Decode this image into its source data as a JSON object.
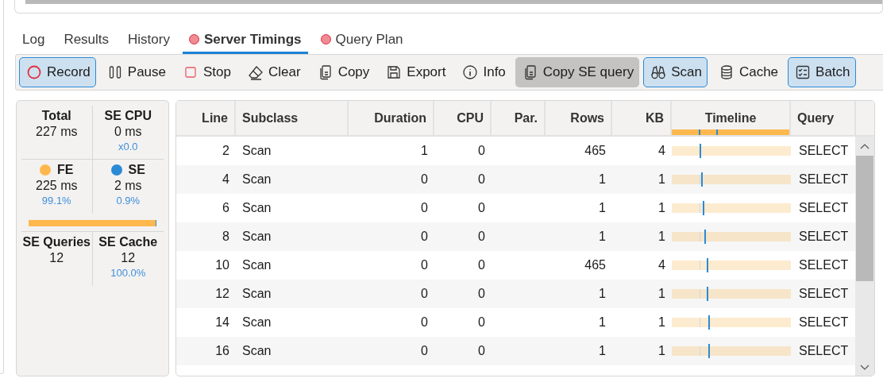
{
  "tabs": [
    {
      "label": "Log",
      "selected": false,
      "indicator": false
    },
    {
      "label": "Results",
      "selected": false,
      "indicator": false
    },
    {
      "label": "History",
      "selected": false,
      "indicator": false
    },
    {
      "label": "Server Timings",
      "selected": true,
      "indicator": true
    },
    {
      "label": "Query Plan",
      "selected": false,
      "indicator": true
    }
  ],
  "toolbar": [
    {
      "label": "Record",
      "kind": "record",
      "selected": true,
      "hovered": false
    },
    {
      "label": "Pause",
      "kind": "pause",
      "selected": false,
      "hovered": false
    },
    {
      "label": "Stop",
      "kind": "stop",
      "selected": false,
      "hovered": false
    },
    {
      "label": "Clear",
      "kind": "eraser",
      "selected": false,
      "hovered": false
    },
    {
      "label": "Copy",
      "kind": "copy",
      "selected": false,
      "hovered": false
    },
    {
      "label": "Export",
      "kind": "save",
      "selected": false,
      "hovered": false
    },
    {
      "label": "Info",
      "kind": "info",
      "selected": false,
      "hovered": false
    },
    {
      "label": "Copy SE query",
      "kind": "copy",
      "selected": false,
      "hovered": true
    },
    {
      "label": "Scan",
      "kind": "binoculars",
      "selected": true,
      "hovered": false
    },
    {
      "label": "Cache",
      "kind": "database",
      "selected": false,
      "hovered": false
    },
    {
      "label": "Batch",
      "kind": "checklist",
      "selected": true,
      "hovered": false
    }
  ],
  "summary": {
    "cells": [
      {
        "title": "Total",
        "value": "227 ms"
      },
      {
        "title": "SE CPU",
        "value": "0 ms",
        "note": "x0.0"
      },
      {
        "title": "FE",
        "value": "225 ms",
        "note": "99.1%",
        "color": "#ffb84d"
      },
      {
        "title": "SE",
        "value": "2 ms",
        "note": "0.9%",
        "color": "#2b8ad6"
      },
      {
        "title": "SE Queries",
        "value": "12"
      },
      {
        "title": "SE Cache",
        "value": "12",
        "note": "100.0%"
      }
    ]
  },
  "table": {
    "columns": [
      "Line",
      "Subclass",
      "Duration",
      "CPU",
      "Par.",
      "Rows",
      "KB",
      "Timeline",
      "Query"
    ],
    "rows": [
      {
        "line": "2",
        "subclass": "Scan",
        "duration": "1",
        "cpu": "0",
        "rows": "465",
        "kb": "4",
        "timeline": {
          "level": 0.23
        },
        "query": "SELECT"
      },
      {
        "line": "4",
        "subclass": "Scan",
        "duration": "0",
        "cpu": "0",
        "rows": "1",
        "kb": "1",
        "timeline": {
          "level": 0.245
        },
        "query": "SELECT"
      },
      {
        "line": "6",
        "subclass": "Scan",
        "duration": "0",
        "cpu": "0",
        "rows": "1",
        "kb": "1",
        "timeline": {
          "level": 0.26
        },
        "query": "SELECT"
      },
      {
        "line": "8",
        "subclass": "Scan",
        "duration": "0",
        "cpu": "0",
        "rows": "1",
        "kb": "1",
        "timeline": {
          "level": 0.275
        },
        "query": "SELECT"
      },
      {
        "line": "10",
        "subclass": "Scan",
        "duration": "0",
        "cpu": "0",
        "rows": "465",
        "kb": "4",
        "timeline": {
          "level": 0.29
        },
        "query": "SELECT"
      },
      {
        "line": "12",
        "subclass": "Scan",
        "duration": "0",
        "cpu": "0",
        "rows": "1",
        "kb": "1",
        "timeline": {
          "level": 0.29
        },
        "query": "SELECT"
      },
      {
        "line": "14",
        "subclass": "Scan",
        "duration": "0",
        "cpu": "0",
        "rows": "1",
        "kb": "1",
        "timeline": {
          "level": 0.305
        },
        "query": "SELECT"
      },
      {
        "line": "16",
        "subclass": "Scan",
        "duration": "0",
        "cpu": "0",
        "rows": "1",
        "kb": "1",
        "timeline": {
          "level": 0.305
        },
        "query": "SELECT"
      }
    ]
  }
}
